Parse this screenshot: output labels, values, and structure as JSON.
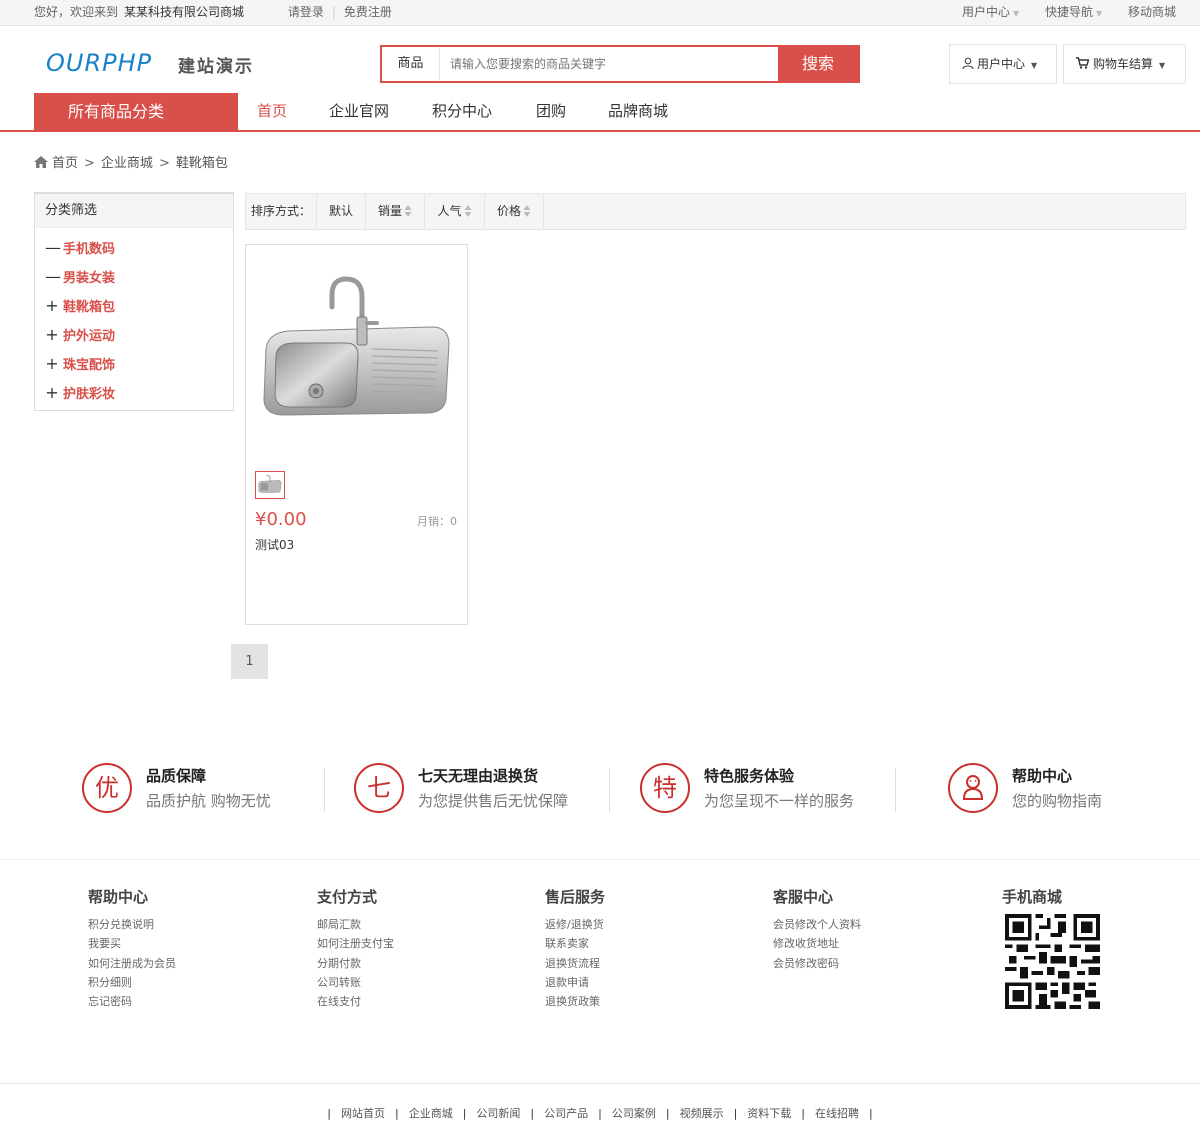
{
  "topbar": {
    "welcome": "您好，欢迎来到",
    "company": "某某科技有限公司商城",
    "login": "请登录",
    "register": "免费注册",
    "right": [
      "用户中心",
      "快捷导航",
      "移动商城"
    ]
  },
  "header": {
    "logo": "OURPHP",
    "logo_sub": "建站演示",
    "search_category": "商品",
    "search_placeholder": "请输入您要搜索的商品关键字",
    "search_button": "搜索",
    "user_center": "用户中心",
    "cart": "购物车结算"
  },
  "nav": {
    "all_categories": "所有商品分类",
    "items": [
      "首页",
      "企业官网",
      "积分中心",
      "团购",
      "品牌商城"
    ]
  },
  "breadcrumb": [
    "首页",
    "企业商城",
    "鞋靴箱包"
  ],
  "sidebar": {
    "title": "分类筛选",
    "items": [
      {
        "sym": "—",
        "label": "手机数码"
      },
      {
        "sym": "—",
        "label": "男装女装"
      },
      {
        "sym": "+",
        "label": "鞋靴箱包"
      },
      {
        "sym": "+",
        "label": "护外运动"
      },
      {
        "sym": "+",
        "label": "珠宝配饰"
      },
      {
        "sym": "+",
        "label": "护肤彩妆"
      }
    ]
  },
  "sort": {
    "label": "排序方式：",
    "options": [
      "默认",
      "销量",
      "人气",
      "价格"
    ]
  },
  "product": {
    "price": "¥0.00",
    "sales": "月销：0",
    "name": "测试03"
  },
  "pager": {
    "current": "1"
  },
  "guarantees": [
    {
      "icon": "优",
      "title": "品质保障",
      "desc": "品质护航 购物无忧"
    },
    {
      "icon": "七",
      "title": "七天无理由退换货",
      "desc": "为您提供售后无忧保障"
    },
    {
      "icon": "特",
      "title": "特色服务体验",
      "desc": "为您呈现不一样的服务"
    },
    {
      "icon": "",
      "title": "帮助中心",
      "desc": "您的购物指南"
    }
  ],
  "footer": {
    "columns": [
      {
        "title": "帮助中心",
        "links": [
          "积分兑换说明",
          "我要买",
          "如何注册成为会员",
          "积分细则",
          "忘记密码"
        ]
      },
      {
        "title": "支付方式",
        "links": [
          "邮局汇款",
          "如何注册支付宝",
          "分期付款",
          "公司转账",
          "在线支付"
        ]
      },
      {
        "title": "售后服务",
        "links": [
          "返修/退换货",
          "联系卖家",
          "退换货流程",
          "退款申请",
          "退换货政策"
        ]
      },
      {
        "title": "客服中心",
        "links": [
          "会员修改个人资料",
          "修改收货地址",
          "会员修改密码"
        ]
      },
      {
        "title": "手机商城",
        "links": []
      }
    ],
    "bottom_links": [
      "网站首页",
      "企业商城",
      "公司新闻",
      "公司产品",
      "公司案例",
      "视频展示",
      "资料下载",
      "在线招聘"
    ]
  },
  "colors": {
    "accent": "#d9504a",
    "brand_blue": "#1a82c8"
  }
}
